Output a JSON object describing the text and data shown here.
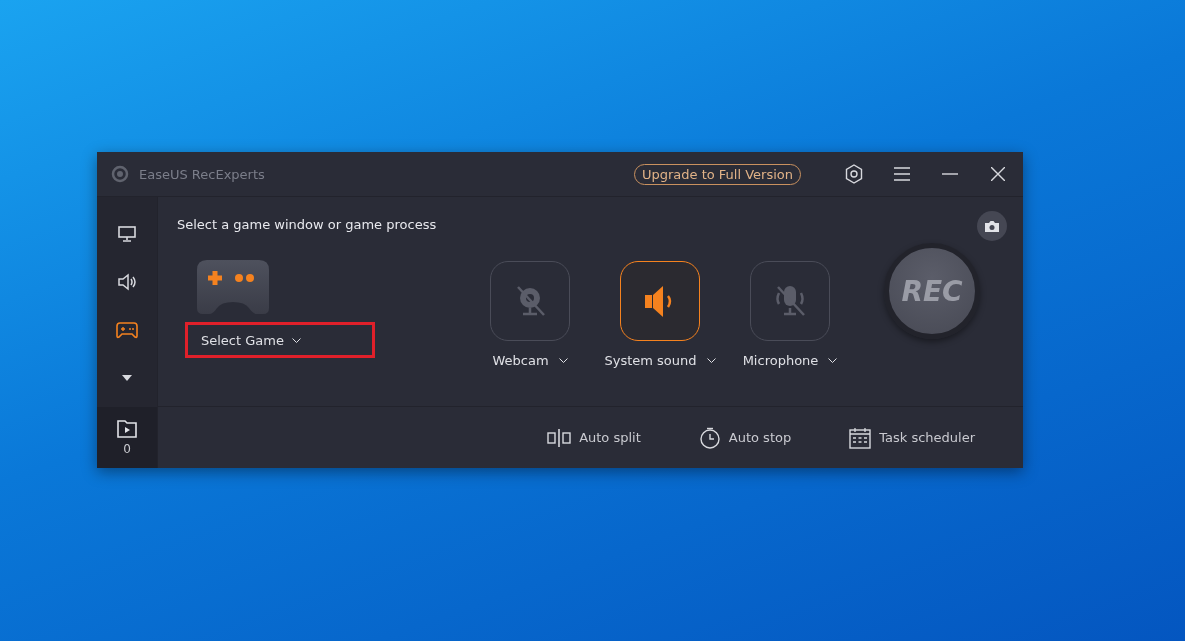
{
  "window": {
    "title": "EaseUS RecExperts",
    "upgrade_button": "Upgrade to Full Version"
  },
  "sidebar": {
    "items": [
      {
        "kind": "screen",
        "selected": false
      },
      {
        "kind": "audio",
        "selected": false
      },
      {
        "kind": "game",
        "selected": true
      },
      {
        "kind": "more",
        "selected": false
      }
    ],
    "recordings_count": "0"
  },
  "heading": "Select a game window or game process",
  "game_selector": {
    "label": "Select Game",
    "highlighted": true
  },
  "sources": [
    {
      "kind": "webcam",
      "label": "Webcam",
      "on": false
    },
    {
      "kind": "speaker",
      "label": "System sound",
      "on": true
    },
    {
      "kind": "microphone",
      "label": "Microphone",
      "on": false
    }
  ],
  "rec_button": "REC",
  "tools": [
    {
      "kind": "split",
      "label": "Auto split"
    },
    {
      "kind": "stop",
      "label": "Auto stop"
    },
    {
      "kind": "schedule",
      "label": "Task scheduler"
    }
  ]
}
